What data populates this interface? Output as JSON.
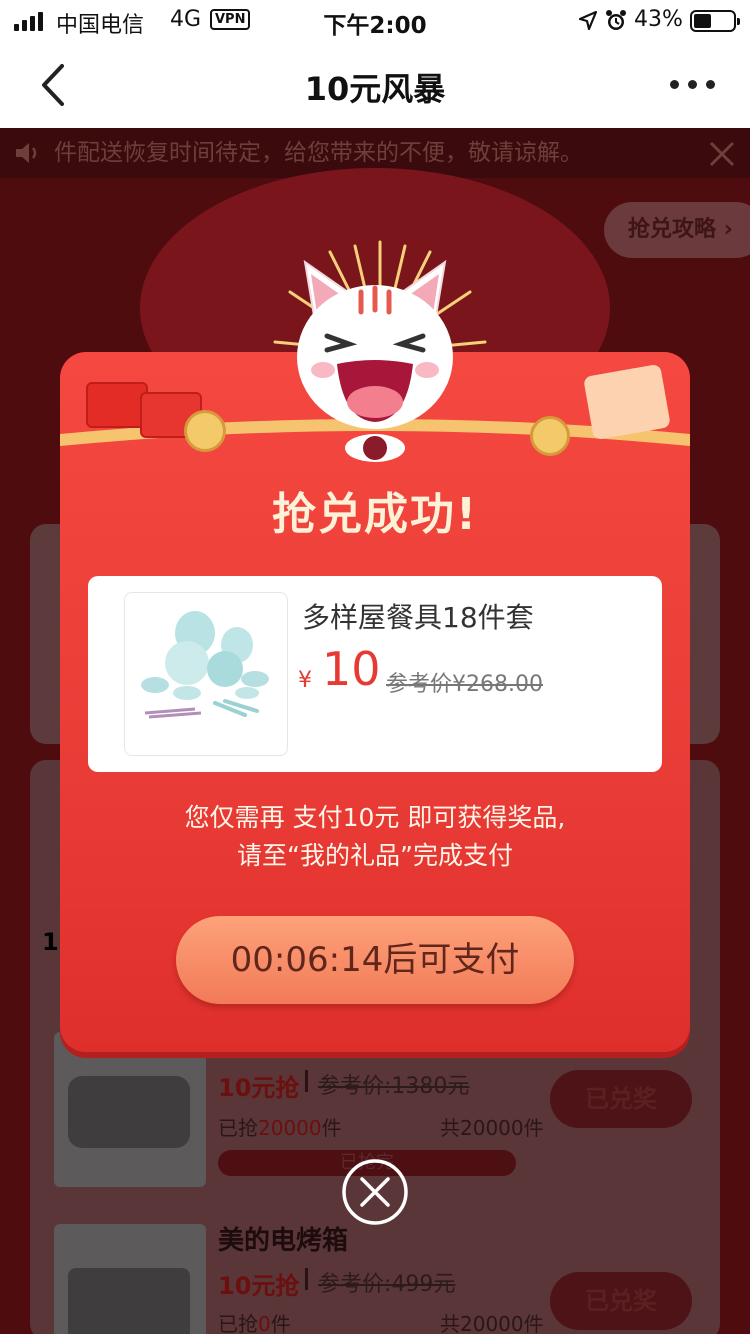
{
  "status_bar": {
    "carrier": "中国电信",
    "network": "4G",
    "vpn": "VPN",
    "time": "下午2:00",
    "battery_pct": "43%"
  },
  "nav": {
    "title": "10元风暴"
  },
  "notice": {
    "text": "件配送恢复时间待定，给您带来的不便，敬请谅解。"
  },
  "guide_label": "抢兑攻略",
  "list_number": "1",
  "items": [
    {
      "price": "10元抢",
      "ref": "参考价:1380元",
      "sold_prefix": "已抢",
      "sold_count": "20000",
      "sold_suffix": "件",
      "total": "共20000件",
      "progress_label": "已抢完",
      "button": "已兑奖"
    },
    {
      "name": "美的电烤箱",
      "price": "10元抢",
      "ref": "参考价:499元",
      "sold_prefix": "已抢",
      "sold_count": "0",
      "sold_suffix": "件",
      "total": "共20000件",
      "button": "已兑奖"
    }
  ],
  "modal": {
    "title": "抢兑成功!",
    "product": {
      "name": "多样屋餐具18件套",
      "currency": "¥",
      "price": "10",
      "ref_price": "参考价¥268.00"
    },
    "message_line1": "您仅需再 支付10元 即可获得奖品,",
    "message_line2": "请至“我的礼品”完成支付",
    "pay_button": "00:06:14后可支付"
  },
  "colors": {
    "modal_red": "#ea3c36",
    "pay_button": "#f5875f",
    "title_gold": "#fdf1d8",
    "price_red": "#e63a33"
  }
}
